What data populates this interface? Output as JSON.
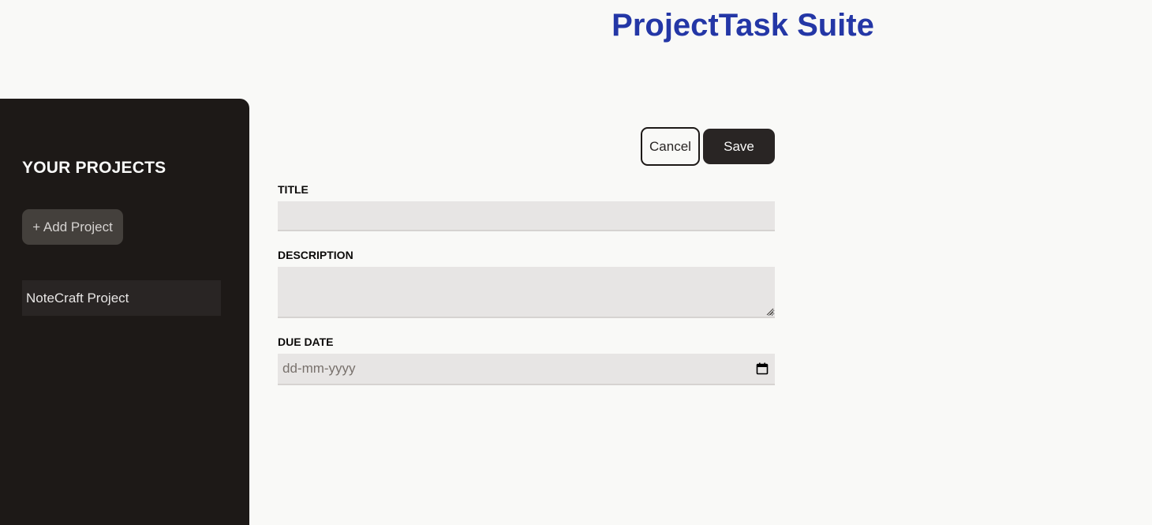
{
  "header": {
    "title": "ProjectTask Suite"
  },
  "sidebar": {
    "heading": "YOUR PROJECTS",
    "add_button_label": "+ Add Project",
    "projects": [
      {
        "label": "NoteCraft Project"
      }
    ]
  },
  "form": {
    "cancel_label": "Cancel",
    "save_label": "Save",
    "title_label": "TITLE",
    "title_value": "",
    "description_label": "DESCRIPTION",
    "description_value": "",
    "due_date_label": "DUE DATE",
    "due_date_placeholder": "dd-mm-yyyy"
  },
  "colors": {
    "title": "#2437a6",
    "sidebar_bg": "#1d1917",
    "button_dark": "#292524",
    "input_bg": "#e7e5e4",
    "page_bg": "#f9f9f7"
  },
  "icons": {
    "date_field": "calendar-icon",
    "textarea": "resize-grip-icon"
  }
}
